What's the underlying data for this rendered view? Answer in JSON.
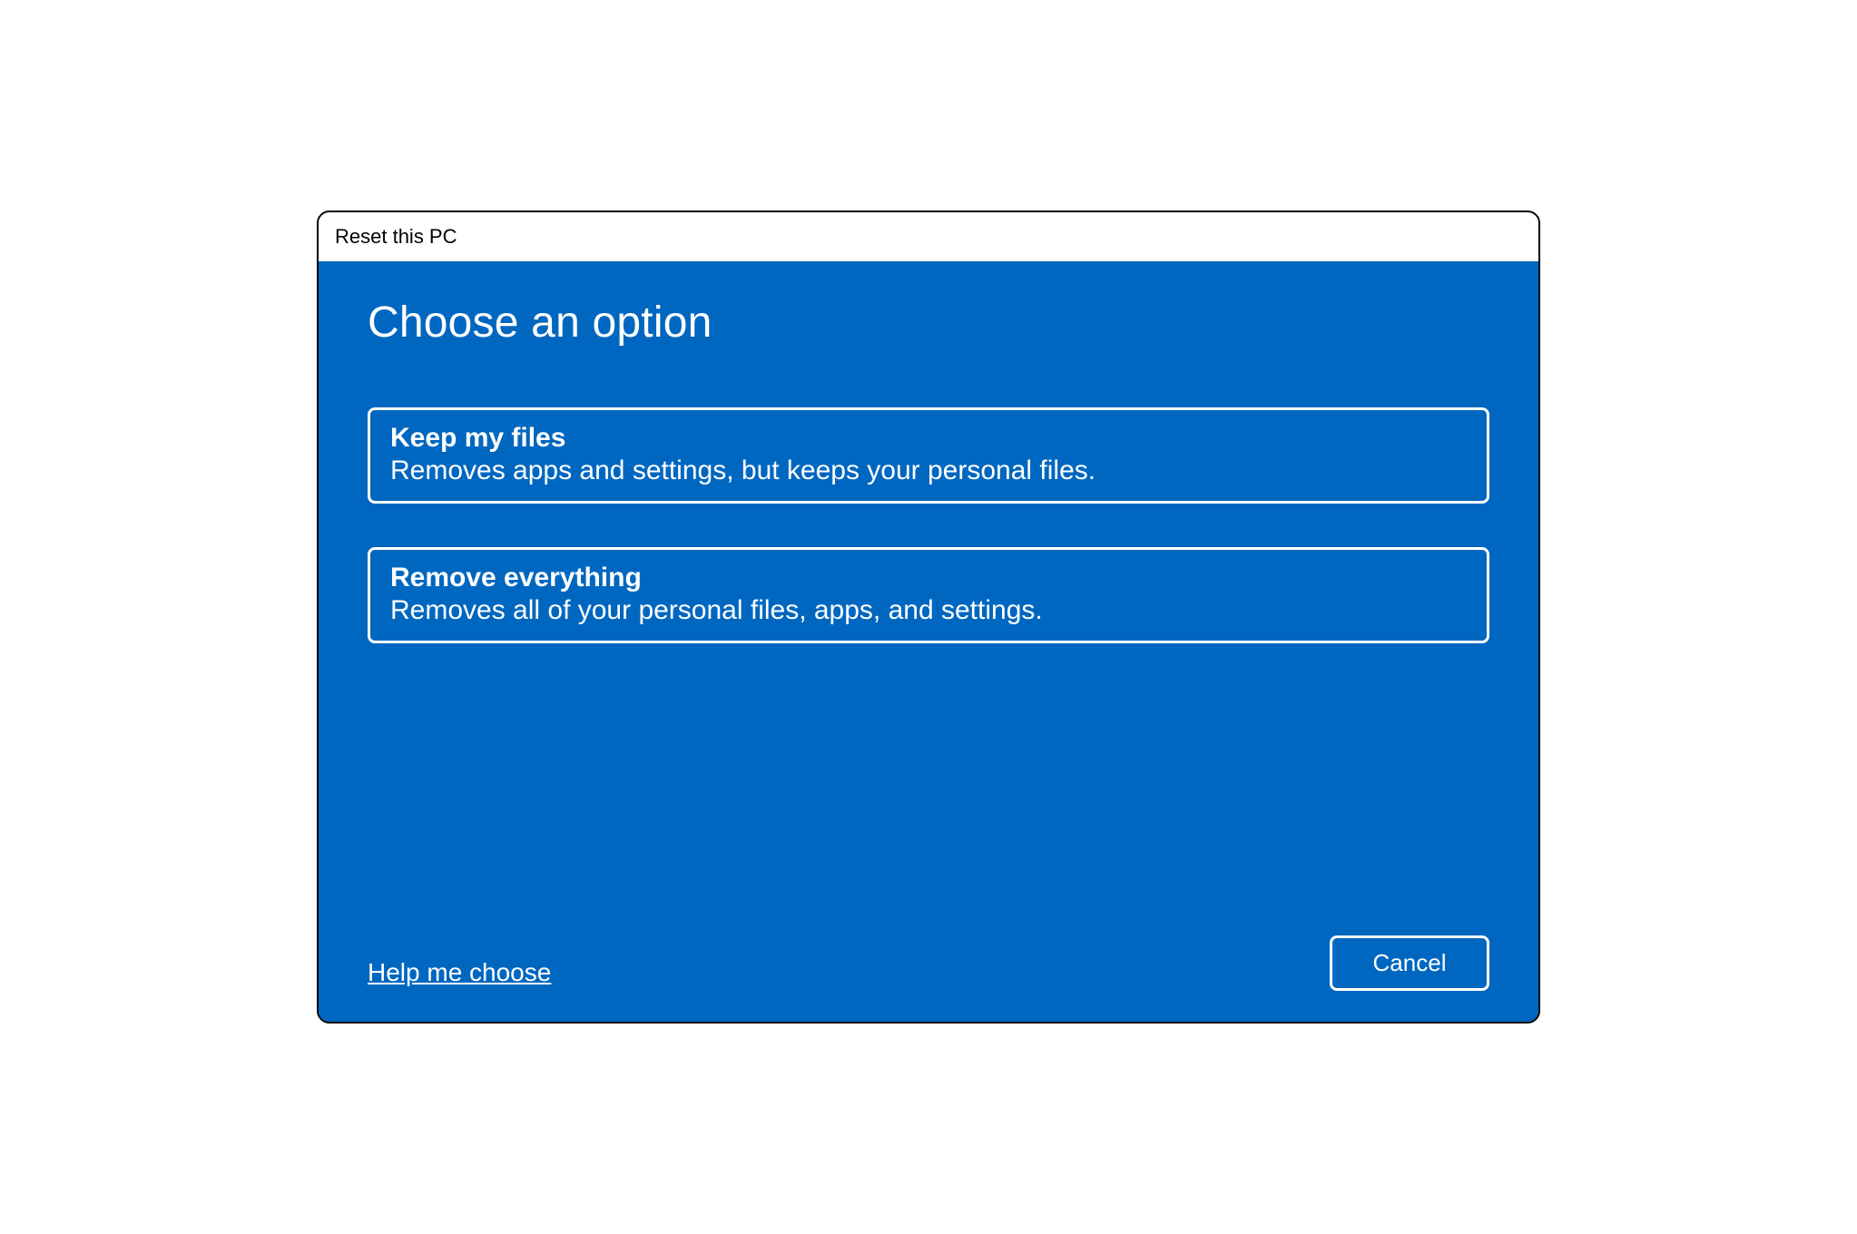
{
  "window": {
    "title": "Reset this PC"
  },
  "main": {
    "heading": "Choose an option",
    "options": [
      {
        "title": "Keep my files",
        "description": "Removes apps and settings, but keeps your personal files."
      },
      {
        "title": "Remove everything",
        "description": "Removes all of your personal files, apps, and settings."
      }
    ]
  },
  "footer": {
    "help_link": "Help me choose",
    "cancel_label": "Cancel"
  },
  "colors": {
    "accent": "#0067C0",
    "text_on_accent": "#ffffff",
    "titlebar_background": "#ffffff",
    "titlebar_text": "#000000",
    "window_border": "#000000"
  }
}
